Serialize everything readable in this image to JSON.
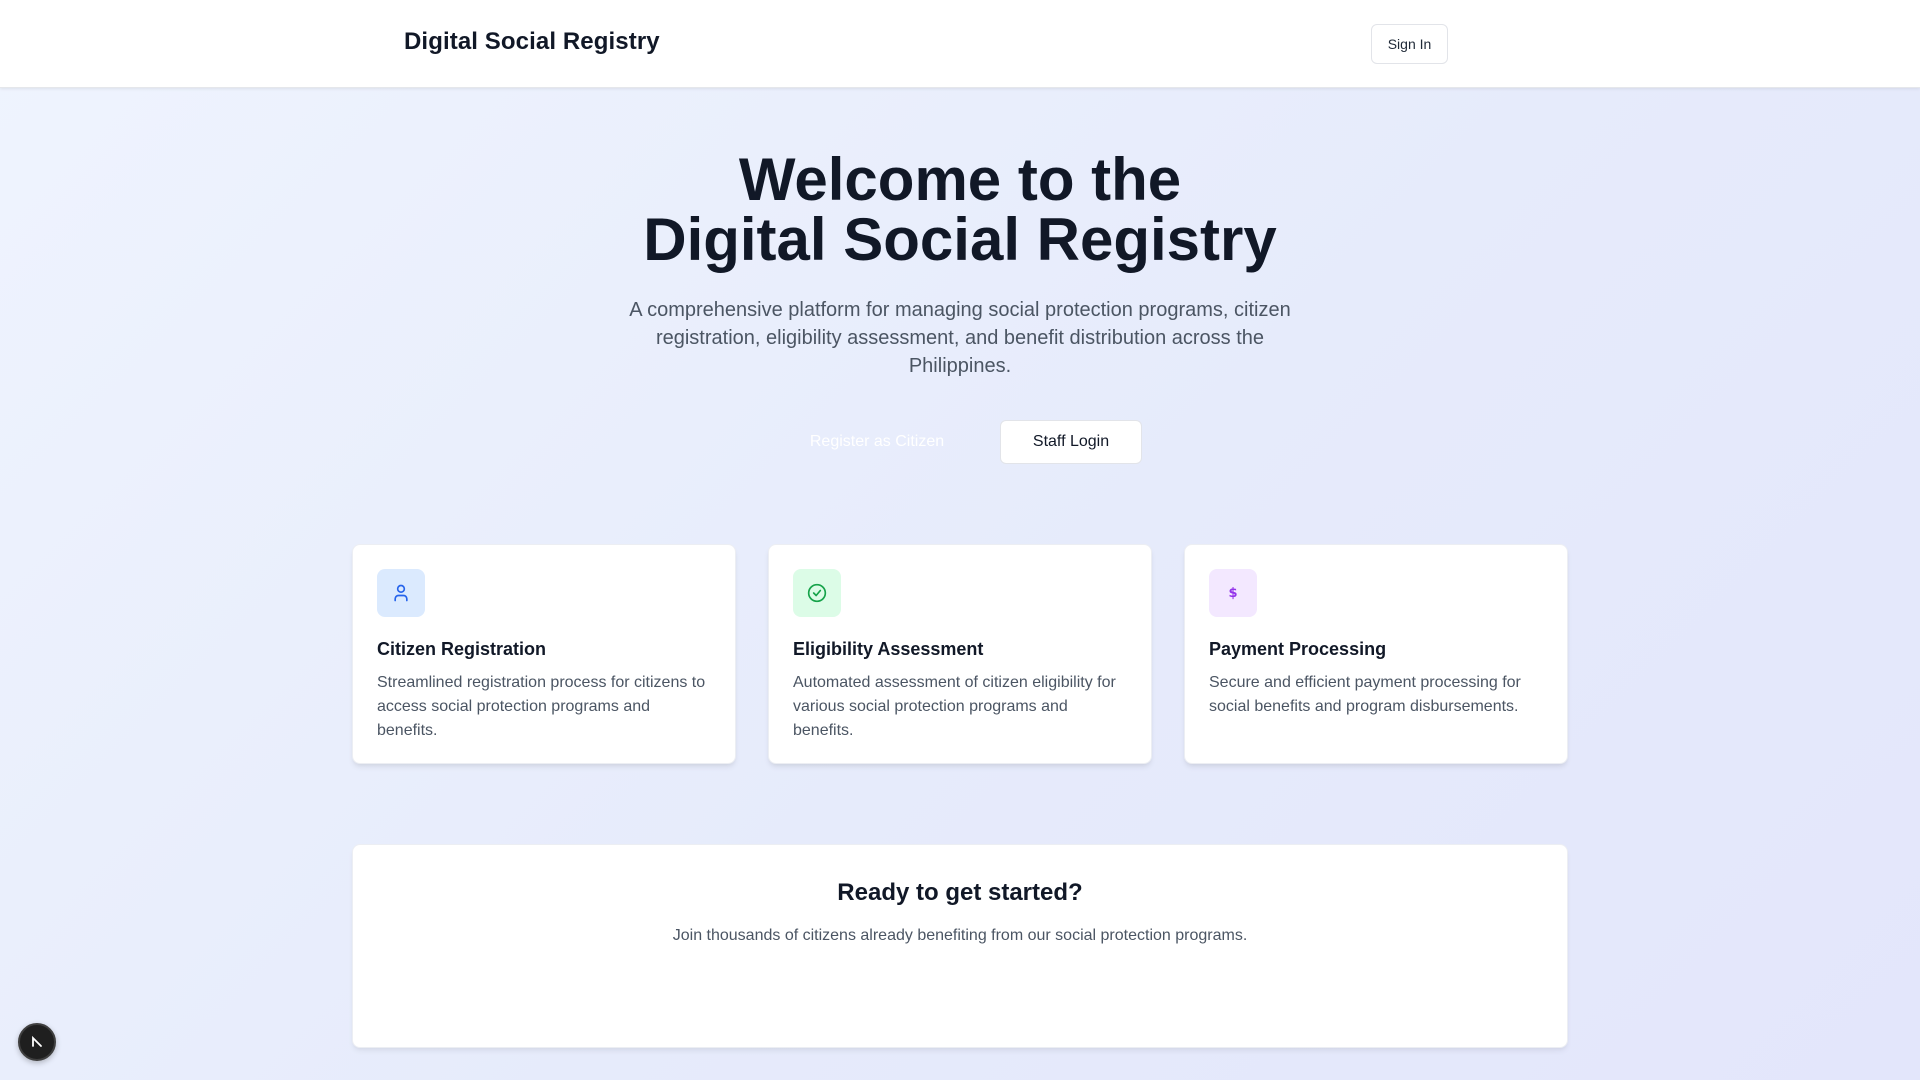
{
  "header": {
    "brand": "Digital Social Registry",
    "sign_in_label": "Sign In"
  },
  "hero": {
    "title_line1": "Welcome to the",
    "title_line2": "Digital Social Registry",
    "subtitle": "A comprehensive platform for managing social protection programs, citizen registration, eligibility assessment, and benefit distribution across the Philippines.",
    "register_label": "Register as Citizen",
    "staff_login_label": "Staff Login"
  },
  "features": [
    {
      "icon": "user-icon",
      "icon_bg": "#dbeafe",
      "icon_color": "#2563eb",
      "title": "Citizen Registration",
      "description": "Streamlined registration process for citizens to access social protection programs and benefits."
    },
    {
      "icon": "check-circle-icon",
      "icon_bg": "#dcfce7",
      "icon_color": "#16a34a",
      "title": "Eligibility Assessment",
      "description": "Automated assessment of citizen eligibility for various social protection programs and benefits."
    },
    {
      "icon": "dollar-icon",
      "icon_bg": "#f3e8ff",
      "icon_color": "#9333ea",
      "title": "Payment Processing",
      "description": "Secure and efficient payment processing for social benefits and program disbursements."
    }
  ],
  "cta": {
    "title": "Ready to get started?",
    "subtitle": "Join thousands of citizens already benefiting from our social protection programs."
  },
  "dev_badge": {
    "icon": "next-logo-icon"
  }
}
